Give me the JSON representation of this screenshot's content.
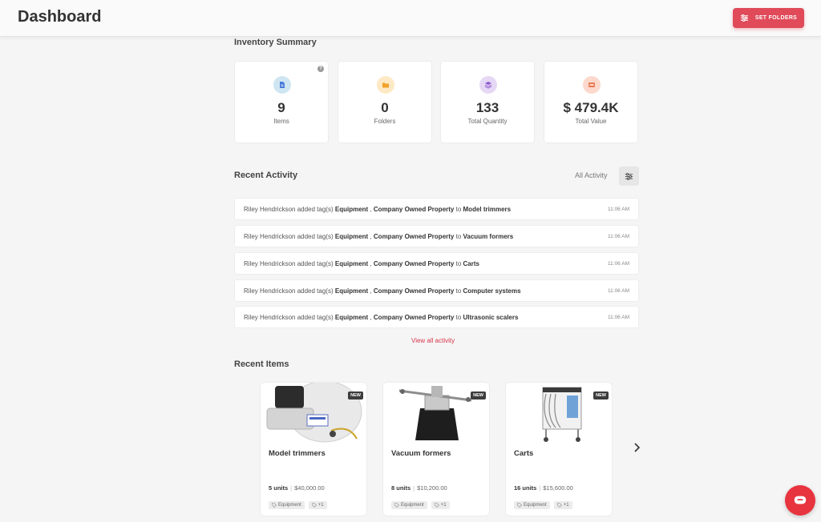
{
  "header": {
    "title": "Dashboard",
    "set_folders_label": "SET FOLDERS"
  },
  "inventory": {
    "title": "Inventory Summary",
    "help": "?",
    "stats": [
      {
        "value": "9",
        "label": "Items",
        "icon": "document-icon",
        "color": "#4a7bd8"
      },
      {
        "value": "0",
        "label": "Folders",
        "icon": "folder-icon",
        "color": "#f2a22c"
      },
      {
        "value": "133",
        "label": "Total Quantity",
        "icon": "layers-icon",
        "color": "#8a56c9"
      },
      {
        "value": "$ 479.4K",
        "label": "Total Value",
        "icon": "wallet-icon",
        "color": "#e87a55"
      }
    ]
  },
  "activity": {
    "title": "Recent Activity",
    "filter_label": "All Activity",
    "view_all": "View all activity",
    "rows": [
      {
        "user": "Riley Hendrickson",
        "action": "added tag(s)",
        "tag1": "Equipment",
        "sep": ",",
        "tag2": "Company Owned Property",
        "to": "to",
        "target": "Model trimmers",
        "time": "11:06 AM"
      },
      {
        "user": "Riley Hendrickson",
        "action": "added tag(s)",
        "tag1": "Equipment",
        "sep": ",",
        "tag2": "Company Owned Property",
        "to": "to",
        "target": "Vacuum formers",
        "time": "11:06 AM"
      },
      {
        "user": "Riley Hendrickson",
        "action": "added tag(s)",
        "tag1": "Equipment",
        "sep": ",",
        "tag2": "Company Owned Property",
        "to": "to",
        "target": "Carts",
        "time": "11:06 AM"
      },
      {
        "user": "Riley Hendrickson",
        "action": "added tag(s)",
        "tag1": "Equipment",
        "sep": ",",
        "tag2": "Company Owned Property",
        "to": "to",
        "target": "Computer systems",
        "time": "11:06 AM"
      },
      {
        "user": "Riley Hendrickson",
        "action": "added tag(s)",
        "tag1": "Equipment",
        "sep": ",",
        "tag2": "Company Owned Property",
        "to": "to",
        "target": "Ultrasonic scalers",
        "time": "11:06 AM"
      }
    ]
  },
  "recent_items": {
    "title": "Recent Items",
    "items": [
      {
        "name": "Model trimmers",
        "badge": "NEW",
        "units": "5 units",
        "sep": "|",
        "value": "$40,000.00",
        "tag": "Equipment",
        "more": "+1"
      },
      {
        "name": "Vacuum formers",
        "badge": "NEW",
        "units": "8 units",
        "sep": "|",
        "value": "$10,200.00",
        "tag": "Equipment",
        "more": "+1"
      },
      {
        "name": "Carts",
        "badge": "NEW",
        "units": "16 units",
        "sep": "|",
        "value": "$15,600.00",
        "tag": "Equipment",
        "more": "+1"
      }
    ]
  }
}
